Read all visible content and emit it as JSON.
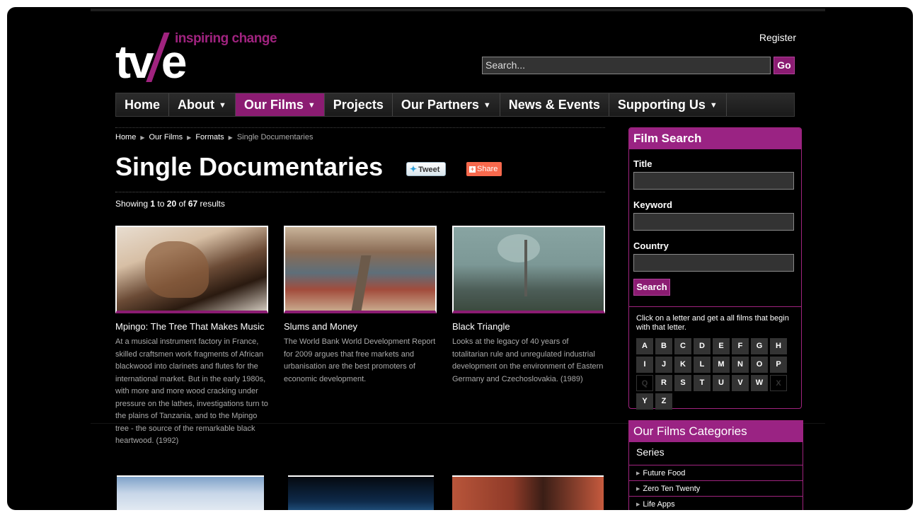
{
  "header": {
    "tagline": "inspiring change",
    "logo_text": "tv/e",
    "register": "Register",
    "search_placeholder": "Search...",
    "go_label": "Go"
  },
  "nav": [
    {
      "label": "Home",
      "caret": false,
      "active": false
    },
    {
      "label": "About",
      "caret": true,
      "active": false
    },
    {
      "label": "Our Films",
      "caret": true,
      "active": true
    },
    {
      "label": "Projects",
      "caret": false,
      "active": false
    },
    {
      "label": "Our Partners",
      "caret": true,
      "active": false
    },
    {
      "label": "News & Events",
      "caret": false,
      "active": false
    },
    {
      "label": "Supporting Us",
      "caret": true,
      "active": false
    }
  ],
  "breadcrumb": {
    "items": [
      "Home",
      "Our Films",
      "Formats"
    ],
    "current": "Single Documentaries"
  },
  "page_title": "Single Documentaries",
  "social": {
    "tweet": "Tweet",
    "share": "Share"
  },
  "results": {
    "prefix": "Showing",
    "from": "1",
    "to_word": "to",
    "to": "20",
    "of_word": "of",
    "total": "67",
    "suffix": "results"
  },
  "films": [
    {
      "title": "Mpingo: The Tree That Makes Music",
      "desc": "At a musical instrument factory in France, skilled craftsmen work fragments of African blackwood into clarinets and flutes for the international market. But in the early 1980s, with more and more wood cracking under pressure on the lathes, investigations turn to the plains of Tanzania, and to the Mpingo tree - the source of the remarkable black heartwood. (1992)"
    },
    {
      "title": "Slums and Money",
      "desc": "The World Bank World Development Report for 2009 argues that free markets and urbanisation are the best promoters of economic development."
    },
    {
      "title": "Black Triangle",
      "desc": "Looks at the legacy of 40 years of totalitarian rule and unregulated industrial development on the environment of Eastern Germany and Czechoslovakia. (1989)"
    }
  ],
  "film_search": {
    "heading": "Film Search",
    "title_label": "Title",
    "keyword_label": "Keyword",
    "country_label": "Country",
    "search_button": "Search",
    "hint": "Click on a letter and get a all films that begin with that letter.",
    "letters": [
      "A",
      "B",
      "C",
      "D",
      "E",
      "F",
      "G",
      "H",
      "I",
      "J",
      "K",
      "L",
      "M",
      "N",
      "O",
      "P",
      "Q",
      "R",
      "S",
      "T",
      "U",
      "V",
      "W",
      "X",
      "Y",
      "Z"
    ],
    "disabled_letters": [
      "Q",
      "X"
    ]
  },
  "categories": {
    "heading": "Our Films Categories",
    "group": "Series",
    "items": [
      "Future Food",
      "Zero Ten Twenty",
      "Life Apps"
    ]
  },
  "colors": {
    "accent": "#9a2383",
    "background": "#000000"
  }
}
